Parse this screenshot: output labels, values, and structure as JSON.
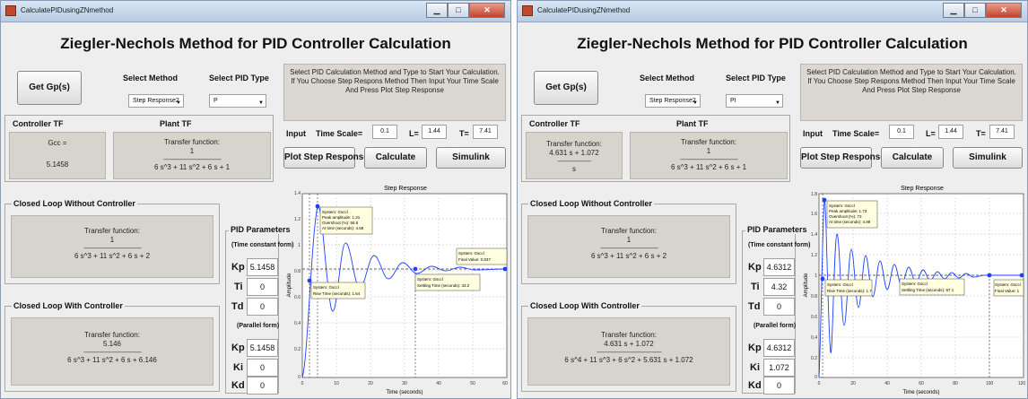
{
  "windows": [
    {
      "title": "CalculatePIDusingZNmethod",
      "heading": "Ziegler-Nechols Method for PID Controller Calculation",
      "get_gp_button": "Get Gp(s)",
      "select_method_label": "Select Method",
      "select_pid_type_label": "Select PID Type",
      "method_value": "Step Response2",
      "pid_type_value": "P",
      "instructions": "Select PID Calculation Method and Type to Start Your Calculation. If You Choose Step Respons Method Then Input Your Time Scale And Press Plot Step Response",
      "input_label": "Input",
      "time_scale_label": "Time Scale=",
      "time_scale_value": "0.1",
      "l_label": "L=",
      "l_value": "1.44",
      "t_label": "T=",
      "t_value": "7.41",
      "plot_button": "Plot Step Response",
      "calculate_button": "Calculate",
      "simulink_button": "Simulink",
      "controller_tf_label": "Controller TF",
      "plant_tf_label": "Plant TF",
      "controller_tf_lines": [
        "Gcc =",
        "",
        "5.1458"
      ],
      "plant_tf_title": "Transfer function:",
      "plant_tf_num": "1",
      "plant_tf_den": "6 s^3 + 11 s^2 + 6 s + 1",
      "closed_loop_without_label": "Closed Loop Without Controller",
      "clw_title": "Transfer function:",
      "clw_num": "1",
      "clw_den": "6 s^3 + 11 s^2 + 6 s + 2",
      "closed_loop_with_label": "Closed Loop With Controller",
      "clc_title": "Transfer function:",
      "clc_num": "5.146",
      "clc_den": "6 s^3 + 11 s^2 + 6 s + 6.146",
      "pid_params_label": "PID Parameters",
      "time_constant_form": "(Time constant form)",
      "parallel_form": "(Parallel form)",
      "kp_label": "Kp",
      "kp_value": "5.1458",
      "ti_label": "Ti",
      "ti_value": "0",
      "td_label": "Td",
      "td_value": "0",
      "kp2_label": "Kp",
      "kp2_value": "5.1458",
      "ki_label": "Ki",
      "ki_value": "0",
      "kd_label": "Kd",
      "kd_value": "0",
      "plot": {
        "title": "Step Response",
        "ylabel": "Amplitude",
        "xlabel": "Time (seconds)",
        "y_ticks": [
          "1.4",
          "1.2",
          "1",
          "0.8",
          "0.6",
          "0.4",
          "0.2",
          "0"
        ],
        "x_ticks": [
          "0",
          "10",
          "20",
          "30",
          "40",
          "50",
          "60"
        ],
        "peak_tip": [
          "System: Gsccl",
          "Peak amplitude: 1.31",
          "Overshoot (%): 56.6",
          "At time (seconds): 4.59"
        ],
        "rise_tip": [
          "System: Gsccl",
          "Rise Time (seconds): 1.64"
        ],
        "settle_tip": [
          "System: Gsccl",
          "Settling Time (seconds): 33.2"
        ],
        "final_tip": [
          "System: Gsccl",
          "Final Value: 0.837"
        ]
      }
    },
    {
      "title": "CalculatePIDusingZNmethod",
      "heading": "Ziegler-Nechols Method for PID Controller Calculation",
      "get_gp_button": "Get Gp(s)",
      "select_method_label": "Select Method",
      "select_pid_type_label": "Select PID Type",
      "method_value": "Step Response2",
      "pid_type_value": "PI",
      "instructions": "Select PID Calculation Method and Type to Start Your Calculation. If You Choose Step Respons Method Then Input Your Time Scale And Press Plot Step Response",
      "input_label": "Input",
      "time_scale_label": "Time Scale=",
      "time_scale_value": "0.1",
      "l_label": "L=",
      "l_value": "1.44",
      "t_label": "T=",
      "t_value": "7.41",
      "plot_button": "Plot Step Response",
      "calculate_button": "Calculate",
      "simulink_button": "Simulink",
      "controller_tf_label": "Controller TF",
      "plant_tf_label": "Plant TF",
      "controller_tf_lines": [
        "Transfer function:",
        "4.631 s + 1.072",
        "s"
      ],
      "plant_tf_title": "Transfer function:",
      "plant_tf_num": "1",
      "plant_tf_den": "6 s^3 + 11 s^2 + 6 s + 1",
      "closed_loop_without_label": "Closed Loop Without Controller",
      "clw_title": "Transfer function:",
      "clw_num": "1",
      "clw_den": "6 s^3 + 11 s^2 + 6 s + 2",
      "closed_loop_with_label": "Closed Loop With Controller",
      "clc_title": "Transfer function:",
      "clc_num": "4.631 s + 1.072",
      "clc_den": "6 s^4 + 11 s^3 + 6 s^2 + 5.631 s + 1.072",
      "pid_params_label": "PID Parameters",
      "time_constant_form": "(Time constant form)",
      "parallel_form": "(Parallel form)",
      "kp_label": "Kp",
      "kp_value": "4.6312",
      "ti_label": "Ti",
      "ti_value": "4.32",
      "td_label": "Td",
      "td_value": "0",
      "kp2_label": "Kp",
      "kp2_value": "4.6312",
      "ki_label": "Ki",
      "ki_value": "1.072",
      "kd_label": "Kd",
      "kd_value": "0",
      "plot": {
        "title": "Step Response",
        "ylabel": "Amplitude",
        "xlabel": "Time (seconds)",
        "y_ticks": [
          "1.8",
          "1.6",
          "1.4",
          "1.2",
          "1",
          "0.8",
          "0.6",
          "0.4",
          "0.2",
          "0"
        ],
        "x_ticks": [
          "0",
          "20",
          "40",
          "60",
          "80",
          "100",
          "120"
        ],
        "peak_tip": [
          "System: Gsccl",
          "Peak amplitude: 1.73",
          "Overshoot (%): 73",
          "At time (seconds): 4.99"
        ],
        "rise_tip": [
          "System: Gsccl",
          "Rise Time (seconds): 1.7"
        ],
        "settle_tip": [
          "System: Gsccl",
          "Settling Time (seconds): 97.1"
        ],
        "final_tip": [
          "System: Gsccl",
          "Final Value: 1"
        ]
      }
    }
  ]
}
